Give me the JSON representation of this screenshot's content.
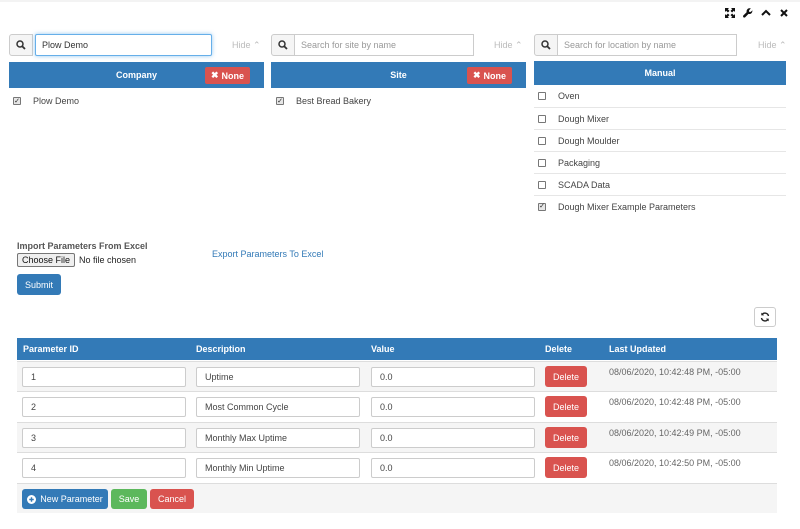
{
  "toolbar": {
    "icons": [
      "expand-icon",
      "wrench-icon",
      "chevron-up-icon",
      "close-icon"
    ]
  },
  "company": {
    "search_value": "Plow Demo",
    "search_placeholder": "",
    "hide_label": "Hide",
    "header": "Company",
    "none_label": "None",
    "items": [
      {
        "label": "Plow Demo",
        "checked": true
      }
    ]
  },
  "site": {
    "search_value": "",
    "search_placeholder": "Search for site by name",
    "hide_label": "Hide",
    "header": "Site",
    "none_label": "None",
    "items": [
      {
        "label": "Best Bread Bakery",
        "checked": true
      }
    ]
  },
  "location": {
    "search_value": "",
    "search_placeholder": "Search for location by name",
    "hide_label": "Hide",
    "header": "Manual",
    "items": [
      {
        "label": "Oven",
        "checked": false
      },
      {
        "label": "Dough Mixer",
        "checked": false
      },
      {
        "label": "Dough Moulder",
        "checked": false
      },
      {
        "label": "Packaging",
        "checked": false
      },
      {
        "label": "SCADA Data",
        "checked": false
      },
      {
        "label": "Dough Mixer Example Parameters",
        "checked": true
      }
    ]
  },
  "import": {
    "label": "Import Parameters From Excel",
    "choose_file": "Choose File",
    "no_file": "No file chosen",
    "export_link": "Export Parameters To Excel",
    "submit": "Submit"
  },
  "table": {
    "columns": [
      "Parameter ID",
      "Description",
      "Value",
      "Delete",
      "Last Updated"
    ],
    "delete_label": "Delete",
    "rows": [
      {
        "id": "1",
        "description": "Uptime",
        "value": "0.0",
        "updated": "08/06/2020, 10:42:48 PM, -05:00"
      },
      {
        "id": "2",
        "description": "Most Common Cycle",
        "value": "0.0",
        "updated": "08/06/2020, 10:42:48 PM, -05:00"
      },
      {
        "id": "3",
        "description": "Monthly Max Uptime",
        "value": "0.0",
        "updated": "08/06/2020, 10:42:49 PM, -05:00"
      },
      {
        "id": "4",
        "description": "Monthly Min Uptime",
        "value": "0.0",
        "updated": "08/06/2020, 10:42:50 PM, -05:00"
      }
    ],
    "new_parameter": "New Parameter",
    "save": "Save",
    "cancel": "Cancel"
  },
  "colors": {
    "primary": "#337ab7",
    "danger": "#d9534f",
    "success": "#5cb85c"
  }
}
